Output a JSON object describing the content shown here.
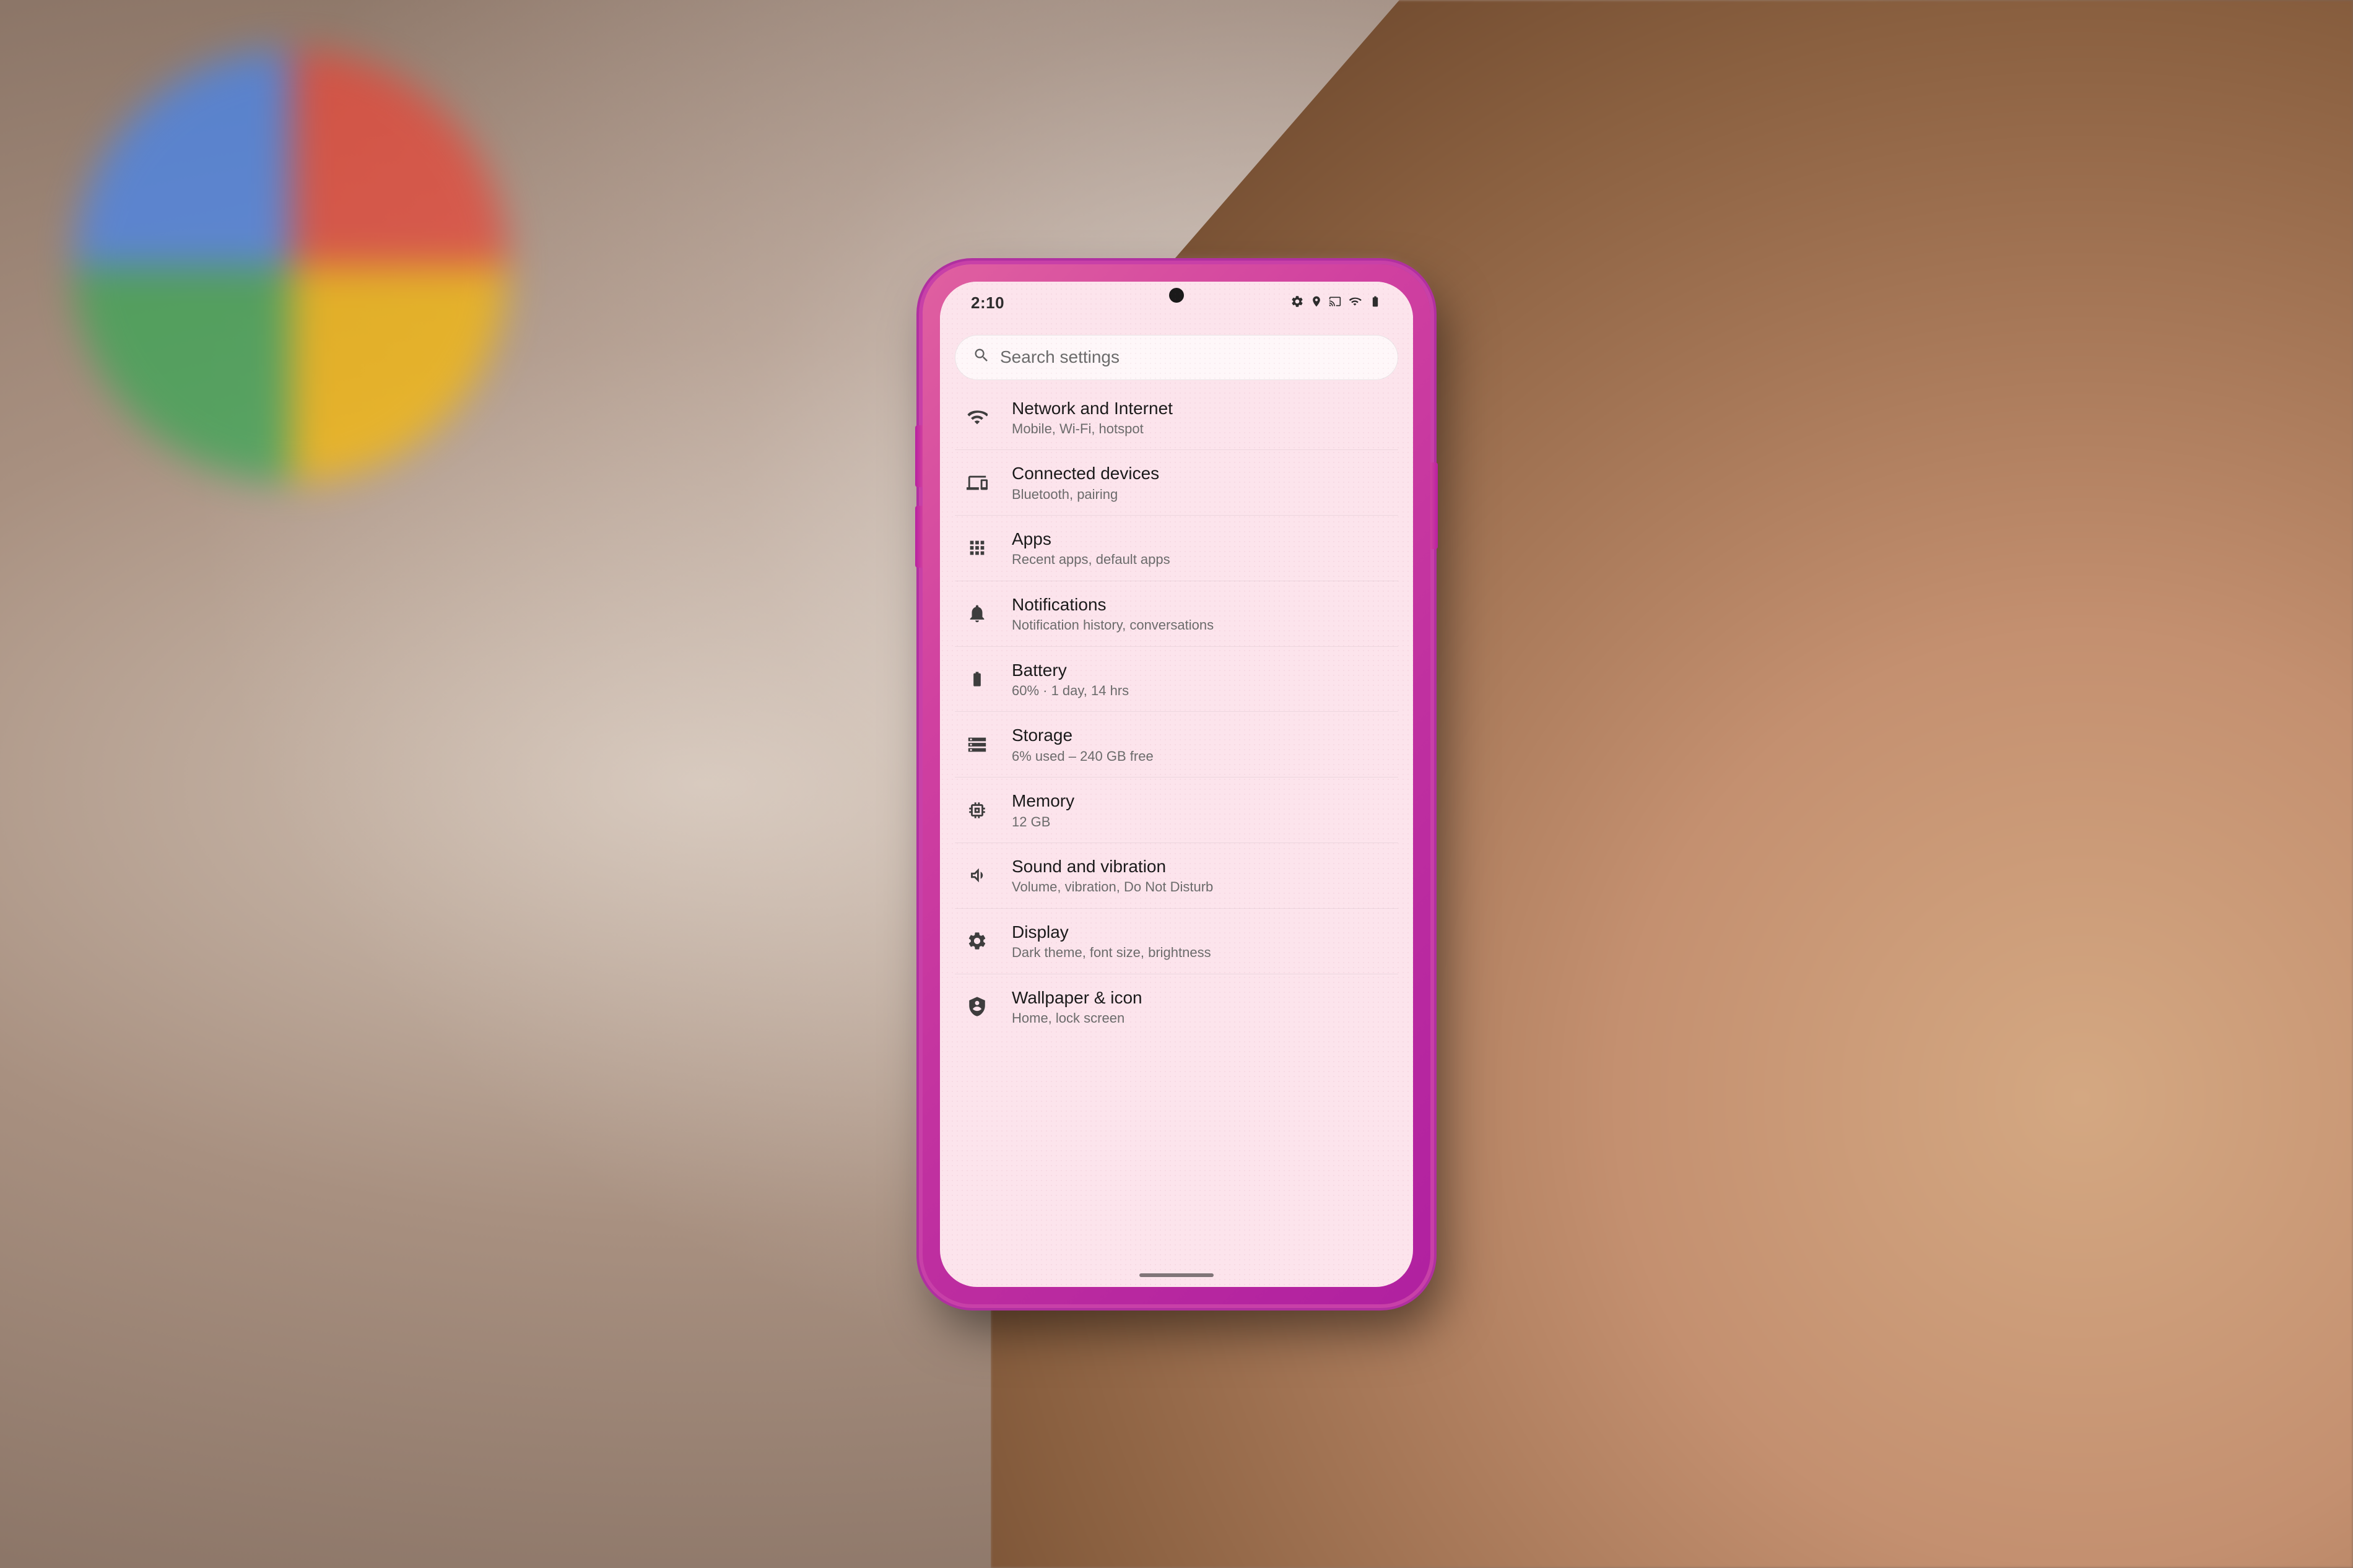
{
  "background": {
    "color": "#b8a89a"
  },
  "phone": {
    "color": "#d040a0"
  },
  "status_bar": {
    "time": "2:10",
    "icons": [
      "settings-icon",
      "location-icon",
      "cast-icon",
      "play-icon",
      "wifi-icon",
      "battery-icon"
    ]
  },
  "search": {
    "placeholder": "Search settings",
    "icon": "search-icon"
  },
  "settings_items": [
    {
      "id": "network",
      "title": "Network and Internet",
      "subtitle": "Mobile, Wi-Fi, hotspot",
      "icon": "wifi-icon"
    },
    {
      "id": "connected-devices",
      "title": "Connected devices",
      "subtitle": "Bluetooth, pairing",
      "icon": "devices-icon"
    },
    {
      "id": "apps",
      "title": "Apps",
      "subtitle": "Recent apps, default apps",
      "icon": "apps-icon"
    },
    {
      "id": "notifications",
      "title": "Notifications",
      "subtitle": "Notification history, conversations",
      "icon": "notifications-icon"
    },
    {
      "id": "battery",
      "title": "Battery",
      "subtitle": "60% · 1 day, 14 hrs",
      "icon": "battery-icon"
    },
    {
      "id": "storage",
      "title": "Storage",
      "subtitle": "6% used – 240 GB free",
      "icon": "storage-icon"
    },
    {
      "id": "memory",
      "title": "Memory",
      "subtitle": "12 GB",
      "icon": "memory-icon"
    },
    {
      "id": "sound",
      "title": "Sound and vibration",
      "subtitle": "Volume, vibration, Do Not Disturb",
      "icon": "sound-icon"
    },
    {
      "id": "display",
      "title": "Display",
      "subtitle": "Dark theme, font size, brightness",
      "icon": "display-icon"
    },
    {
      "id": "wallpaper",
      "title": "Wallpaper & icon",
      "subtitle": "Home, lock screen",
      "icon": "wallpaper-icon"
    }
  ]
}
